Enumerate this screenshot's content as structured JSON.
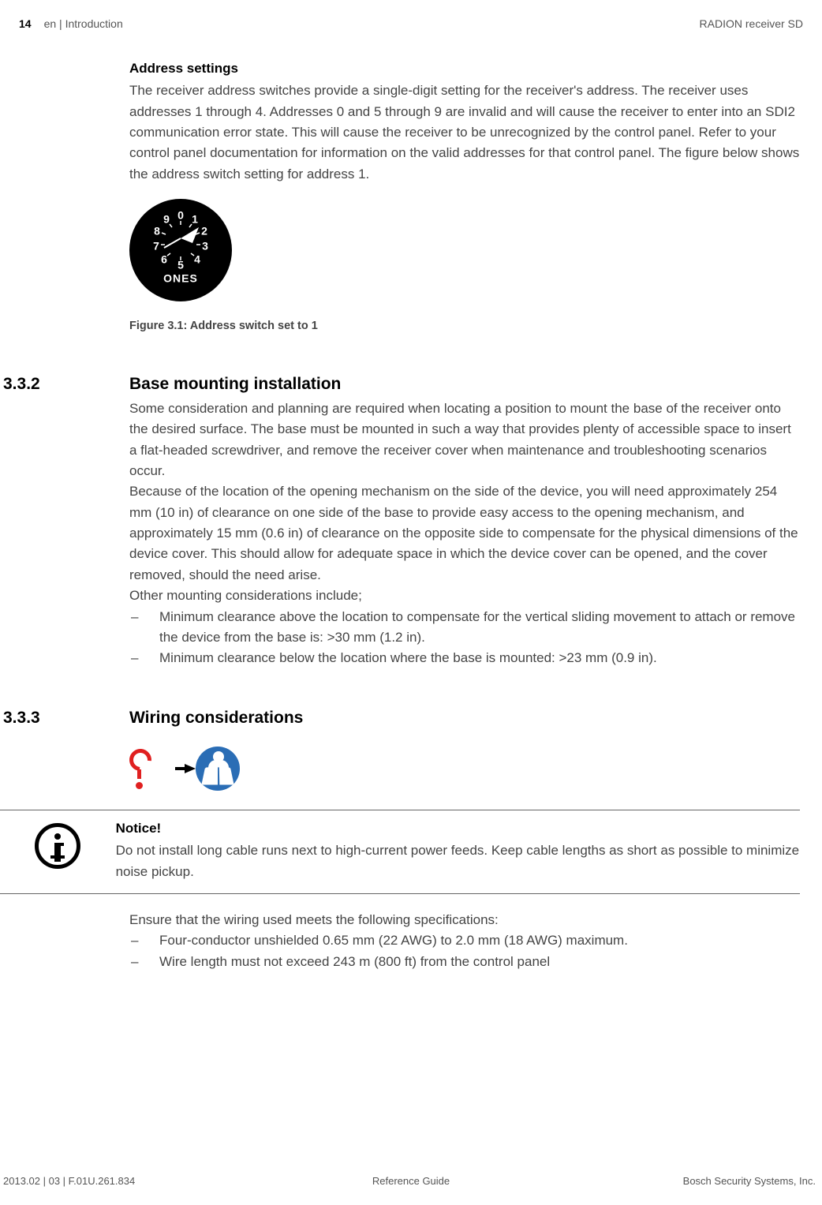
{
  "header": {
    "page": "14",
    "crumb": "en | Introduction",
    "product": "RADION receiver SD"
  },
  "s_addr": {
    "title": "Address settings",
    "body": "The receiver address switches provide a single-digit setting for the receiver's address. The receiver uses addresses 1 through 4. Addresses 0 and 5 through 9 are invalid and will cause the receiver to enter into an SDI2 communication error state. This will cause the receiver to be unrecognized by the control panel. Refer to your control panel documentation for information on the valid addresses for that control panel. The figure below shows the address switch setting for address 1."
  },
  "dial": {
    "labels": [
      "0",
      "1",
      "2",
      "3",
      "4",
      "5",
      "6",
      "7",
      "8",
      "9"
    ],
    "ones": "ONES"
  },
  "fig_caption": "Figure 3.1: Address switch set to 1",
  "s332": {
    "num": "3.3.2",
    "title": "Base mounting installation",
    "p1": "Some consideration and planning are required when locating a position to mount the base of the receiver onto the desired surface. The base must be mounted in such a way that provides plenty of accessible space to insert a flat-headed screwdriver, and remove the receiver cover when maintenance and troubleshooting scenarios occur.",
    "p2": "Because of the location of the opening mechanism on the side of the device, you will need approximately 254 mm (10 in) of clearance on one side of the base to provide easy access to the opening mechanism, and approximately 15 mm (0.6 in) of clearance on the opposite side to compensate for the physical dimensions of the device cover. This should allow for adequate space in which the device cover can be opened, and the cover removed, should the need arise.",
    "p3": "Other mounting considerations include;",
    "items": [
      "Minimum clearance above the location to compensate for the vertical sliding movement to attach or remove the device from the base is: >30 mm (1.2 in).",
      "Minimum clearance below the location where the base is mounted: >23 mm (0.9 in)."
    ]
  },
  "s333": {
    "num": "3.3.3",
    "title": "Wiring considerations"
  },
  "notice": {
    "title": "Notice!",
    "body": "Do not install long cable runs next to high-current power feeds. Keep cable lengths as short as possible to minimize noise pickup."
  },
  "wiring": {
    "lead": "Ensure that the wiring used meets the following specifications:",
    "items": [
      "Four-conductor unshielded 0.65 mm (22 AWG) to 2.0 mm (18 AWG) maximum.",
      "Wire length must not exceed 243 m (800 ft) from the control panel"
    ]
  },
  "footer": {
    "left": "2013.02 | 03 | F.01U.261.834",
    "center": "Reference Guide",
    "right": "Bosch Security Systems, Inc."
  }
}
